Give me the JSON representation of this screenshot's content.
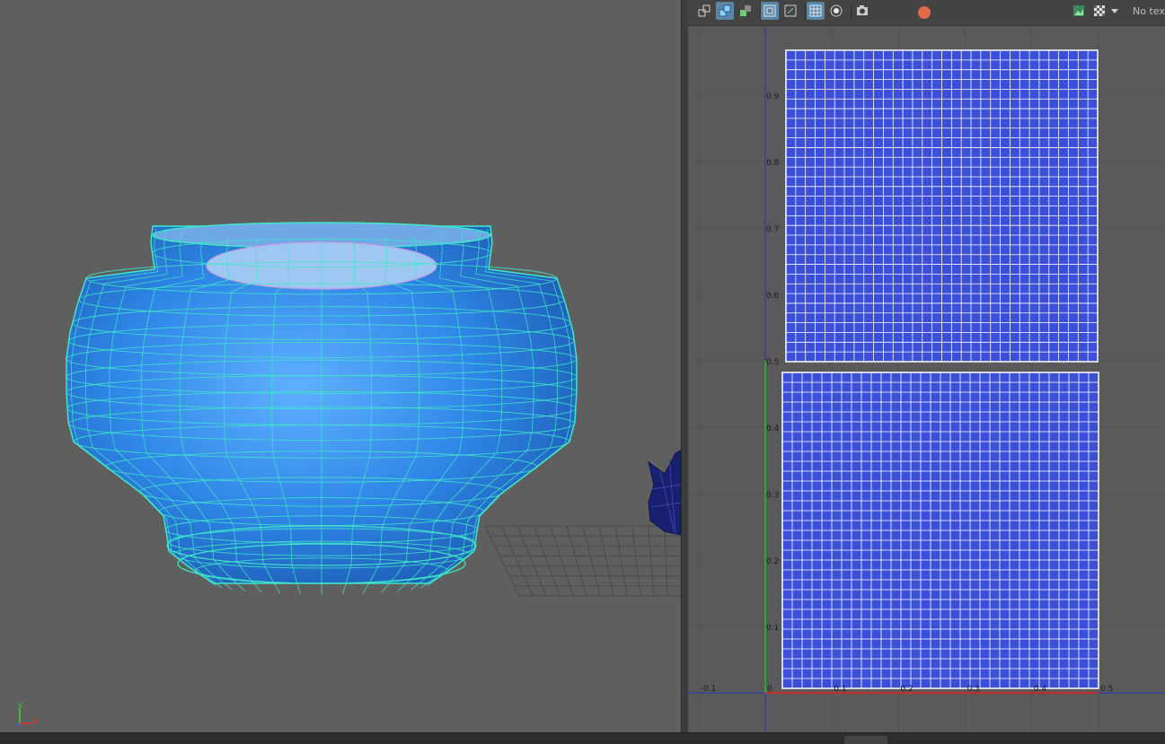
{
  "viewport": {
    "axis_x_label": "x",
    "axis_y_label": "y",
    "axis_z_label": "z",
    "objects": [
      "vase-mesh",
      "cat-mesh",
      "ground-grid"
    ]
  },
  "uv_editor": {
    "toolbar": {
      "buttons": [
        {
          "name": "uv-shell-icon",
          "active": false
        },
        {
          "name": "uv-shell-border-icon",
          "active": true
        },
        {
          "name": "uv-distortion-icon",
          "active": false
        },
        {
          "name": "display-image-icon",
          "active": true
        },
        {
          "name": "image-range-icon",
          "active": false
        },
        {
          "name": "grid-icon",
          "active": true
        },
        {
          "name": "snap-icon",
          "active": false
        },
        {
          "name": "snapshot-icon",
          "active": false
        },
        {
          "name": "image-toggle-icon",
          "active": false
        },
        {
          "name": "checker-icon",
          "active": false
        },
        {
          "name": "dropdown-arrow-icon",
          "active": false
        }
      ],
      "texture_label": "No text"
    },
    "u_ticks": [
      "-0.1",
      "0",
      "0.1",
      "0.2",
      "0.3",
      "0.4",
      "0.5"
    ],
    "v_ticks": [
      "0.1",
      "0.2",
      "0.3",
      "0.4",
      "0.5",
      "0.6",
      "0.7",
      "0.8",
      "0.9"
    ],
    "colors": {
      "uv_fill": "#3b4fd8",
      "uv_lines": "#ffffff",
      "u_axis": "#e02020",
      "v_axis": "#20c020",
      "selection": "#3fe6c8",
      "mesh_fill": "#3d8fe6"
    }
  }
}
